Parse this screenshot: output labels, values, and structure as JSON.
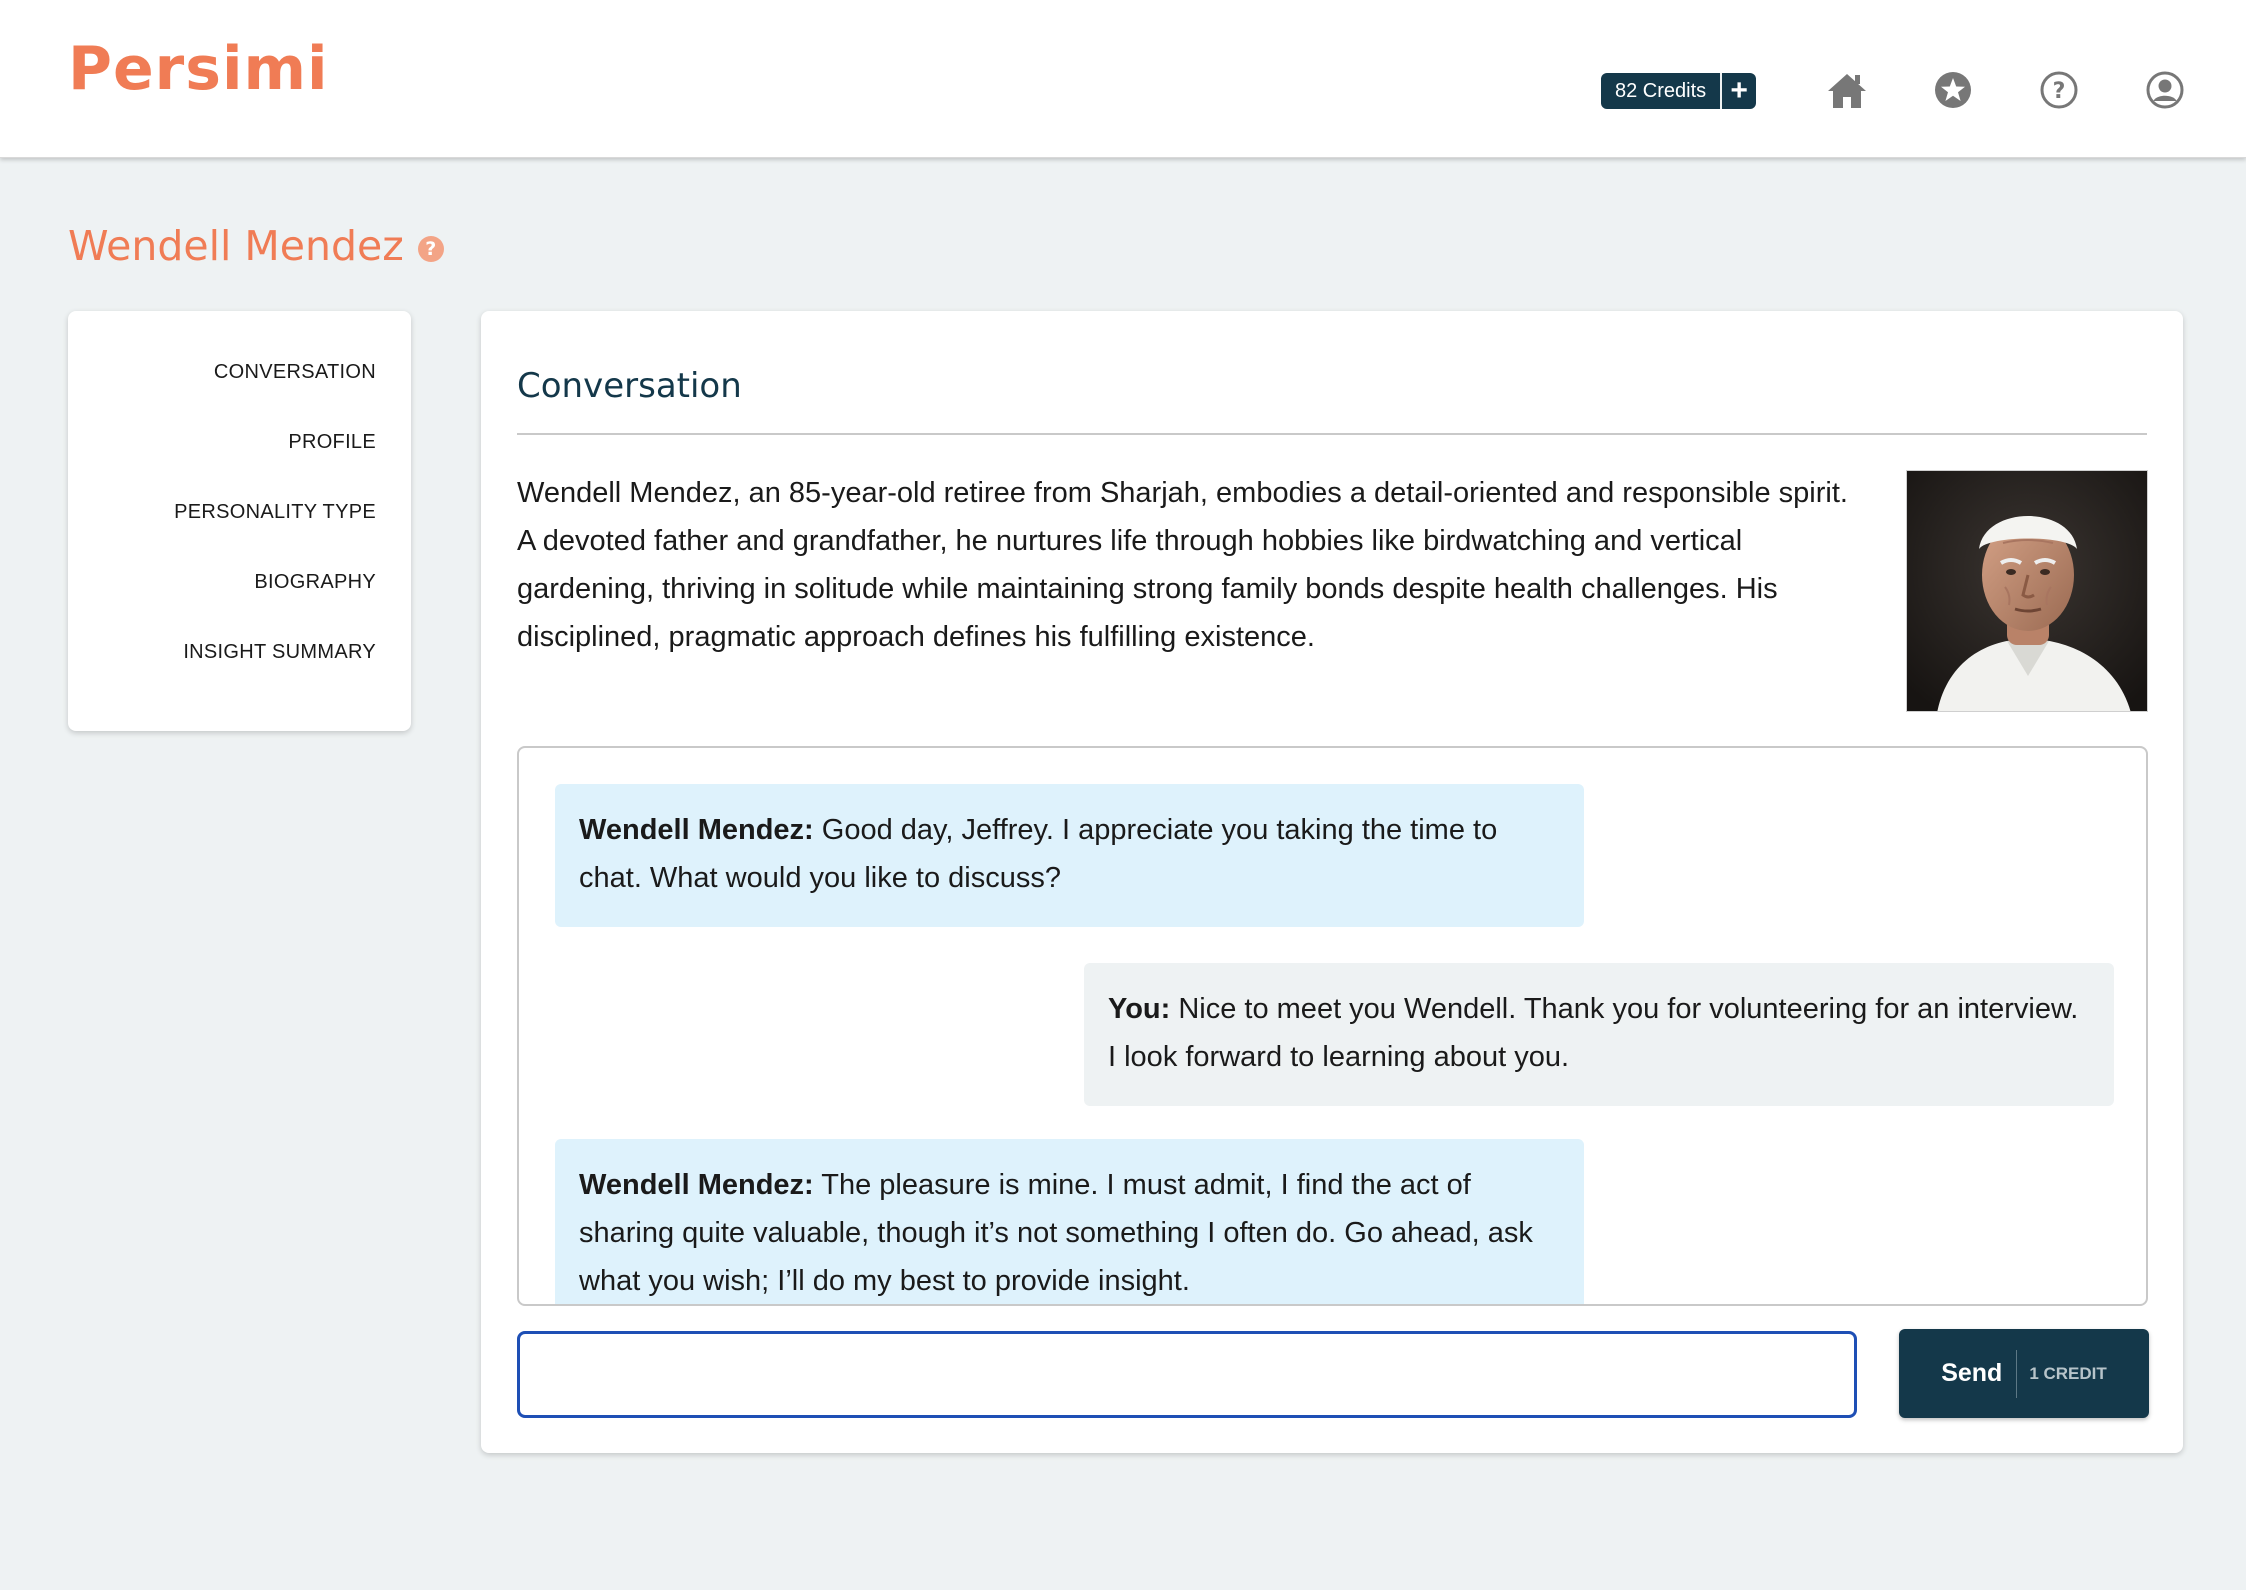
{
  "header": {
    "logo": "Persimi",
    "credits_label": "82 Credits",
    "credits_add": "+",
    "nav_icons": [
      "home-icon",
      "star-icon",
      "help-icon",
      "account-icon"
    ]
  },
  "persona": {
    "name": "Wendell Mendez",
    "help": "?"
  },
  "sidebar": {
    "items": [
      {
        "label": "CONVERSATION"
      },
      {
        "label": "PROFILE"
      },
      {
        "label": "PERSONALITY TYPE"
      },
      {
        "label": "BIOGRAPHY"
      },
      {
        "label": "INSIGHT SUMMARY"
      }
    ]
  },
  "main": {
    "title": "Conversation",
    "intro": "Wendell Mendez, an 85-year-old retiree from Sharjah, embodies a detail-oriented and responsible spirit. A devoted father and grandfather, he nurtures life through hobbies like birdwatching and vertical gardening, thriving in solitude while maintaining strong family bonds despite health challenges. His disciplined, pragmatic approach defines his fulfilling existence."
  },
  "chat": {
    "messages": [
      {
        "speaker": "Wendell Mendez:",
        "text": " Good day, Jeffrey. I appreciate you taking the time to chat. What would you like to discuss?"
      },
      {
        "speaker": "You:",
        "text": " Nice to meet you Wendell. Thank you for volunteering for an interview. I look forward to learning about you."
      },
      {
        "speaker": "Wendell Mendez:",
        "text": " The pleasure is mine. I must admit, I find the act of sharing quite valuable, though it’s not something I often do. Go ahead, ask what you wish; I’ll do my best to provide insight."
      }
    ]
  },
  "composer": {
    "input_value": "",
    "send_label": "Send",
    "send_cost": "1 CREDIT"
  },
  "colors": {
    "brand": "#f07c55",
    "dark": "#14384a",
    "bot_bubble": "#def2fc",
    "user_bubble": "#eef2f3",
    "input_focus": "#1e4fb5"
  }
}
